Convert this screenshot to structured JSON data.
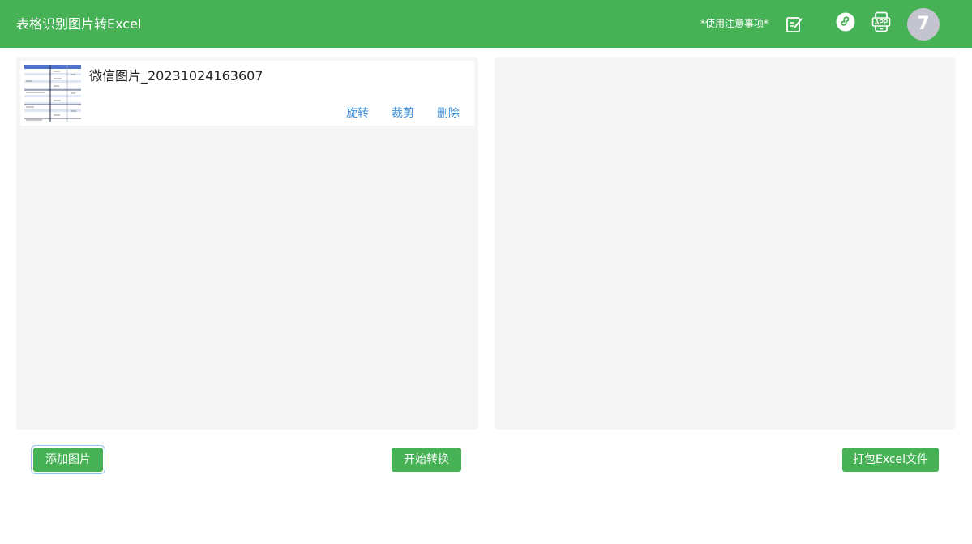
{
  "header": {
    "title": "表格识别图片转Excel",
    "notice": "*使用注意事项*",
    "user_initial": "7"
  },
  "icons": {
    "edit": "edit-note-icon",
    "mini_program": "mini-program-icon",
    "app": "app-download-icon"
  },
  "app_icon_label": "APP",
  "file_list": {
    "items": [
      {
        "name": "微信图片_20231024163607",
        "actions": {
          "rotate": "旋转",
          "crop": "裁剪",
          "delete": "删除"
        }
      }
    ]
  },
  "buttons": {
    "add_image": "添加图片",
    "start_convert": "开始转换",
    "pack_excel": "打包Excel文件"
  },
  "colors": {
    "header": "#46b255",
    "button": "#46b255",
    "link": "#3c8fd8",
    "panel": "#f5f5f5",
    "avatar": "#c4c4ce"
  }
}
